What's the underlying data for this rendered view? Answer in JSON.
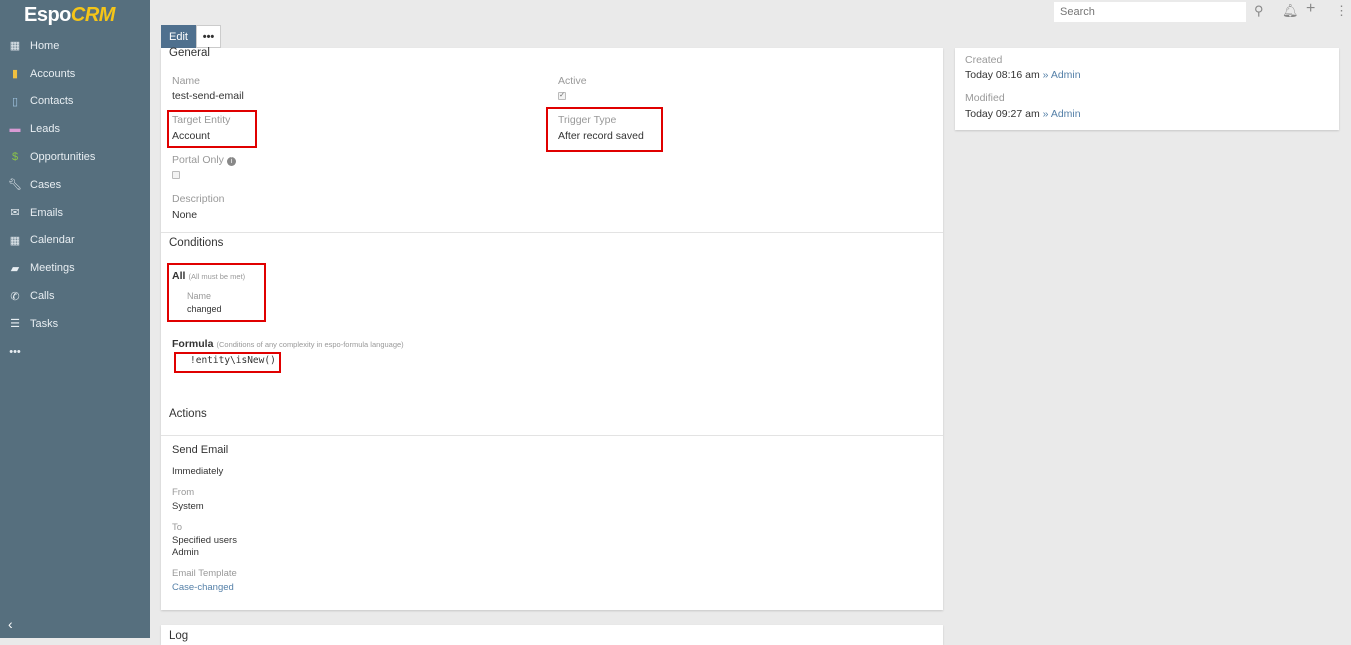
{
  "brand": {
    "name_a": "Espo",
    "name_b": "CRM"
  },
  "sidebar": {
    "items": [
      {
        "label": "Home",
        "icon": "grid-icon",
        "color": "#e8eef2"
      },
      {
        "label": "Accounts",
        "icon": "building-icon",
        "color": "#f0c040"
      },
      {
        "label": "Contacts",
        "icon": "id-badge-icon",
        "color": "#9fc3e0"
      },
      {
        "label": "Leads",
        "icon": "id-card-icon",
        "color": "#d89ad4"
      },
      {
        "label": "Opportunities",
        "icon": "dollar-icon",
        "color": "#8bc34a"
      },
      {
        "label": "Cases",
        "icon": "wrench-icon",
        "color": "#e8eef2"
      },
      {
        "label": "Emails",
        "icon": "envelope-icon",
        "color": "#e8eef2"
      },
      {
        "label": "Calendar",
        "icon": "calendar-icon",
        "color": "#e8eef2"
      },
      {
        "label": "Meetings",
        "icon": "briefcase-icon",
        "color": "#e8eef2"
      },
      {
        "label": "Calls",
        "icon": "phone-icon",
        "color": "#e8eef2"
      },
      {
        "label": "Tasks",
        "icon": "tasks-icon",
        "color": "#e8eef2"
      }
    ]
  },
  "header": {
    "search_placeholder": "Search"
  },
  "toolbar": {
    "edit": "Edit"
  },
  "general": {
    "title": "General",
    "name_label": "Name",
    "name": "test-send-email",
    "active_label": "Active",
    "target_label": "Target Entity",
    "target": "Account",
    "trigger_label": "Trigger Type",
    "trigger": "After record saved",
    "portal_label": "Portal Only",
    "desc_label": "Description",
    "desc": "None"
  },
  "conditions": {
    "title": "Conditions",
    "all": "All",
    "all_note": "(All must be met)",
    "field": "Name",
    "op": "changed",
    "formula": "Formula",
    "formula_note": "(Conditions of any complexity in espo-formula language)",
    "code": "!entity\\isNew()"
  },
  "actions": {
    "title": "Actions",
    "type": "Send Email",
    "when": "Immediately",
    "from_label": "From",
    "from": "System",
    "to_label": "To",
    "to": "Specified users",
    "to_user": "Admin",
    "tpl_label": "Email Template",
    "tpl": "Case-changed"
  },
  "log": {
    "title": "Log"
  },
  "side": {
    "created_label": "Created",
    "created": "Today 08:16 am",
    "created_by": "» Admin",
    "modified_label": "Modified",
    "modified": "Today 09:27 am",
    "modified_by": "» Admin"
  }
}
